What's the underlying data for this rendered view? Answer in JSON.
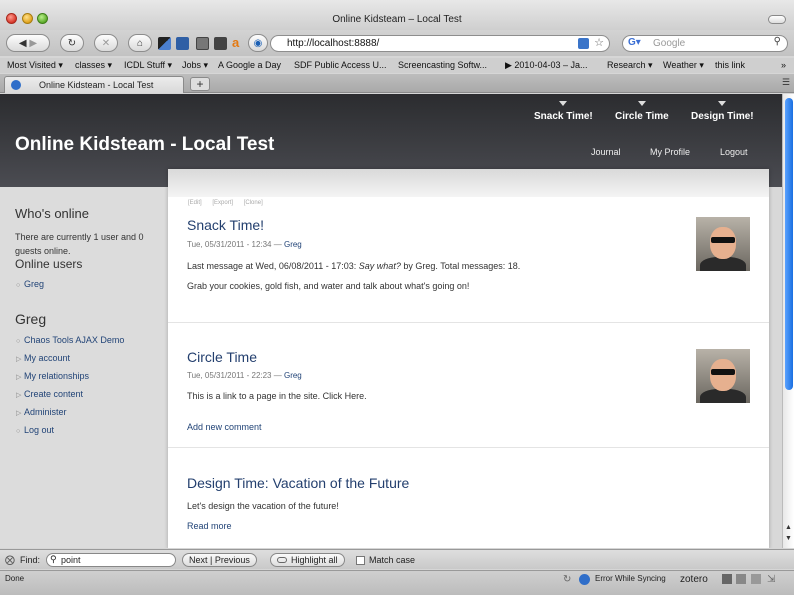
{
  "window": {
    "title": "Online Kidsteam – Local Test"
  },
  "nav": {
    "url": "http://localhost:8888/",
    "search_placeholder": "Google"
  },
  "bookmarks": [
    "Most Visited ▾",
    "classes ▾",
    "ICDL Stuff ▾",
    "Jobs ▾",
    "A Google a Day",
    "SDF Public Access U...",
    "Screencasting Softw...",
    "▶ 2010-04-03 – Ja...",
    "Research ▾",
    "Weather ▾",
    "this link",
    "»"
  ],
  "tab": {
    "label": "Online Kidsteam - Local Test",
    "new_tab": "+"
  },
  "site": {
    "title": "Online Kidsteam - Local Test",
    "primary_links": [
      "Snack Time!",
      "Circle Time",
      "Design Time!"
    ],
    "secondary_links": [
      "Journal",
      "My Profile",
      "Logout"
    ]
  },
  "sidebar": {
    "whos_online_title": "Who's online",
    "whos_online_text": "There are currently 1 user and 0 guests online.",
    "online_users_title": "Online users",
    "online_user": "Greg",
    "user_block_title": "Greg",
    "user_menu": [
      "Chaos Tools AJAX Demo",
      "My account",
      "My relationships",
      "Create content",
      "Administer",
      "Log out"
    ]
  },
  "content": {
    "edit_links": [
      "[Edit]",
      "[Export]",
      "[Clone]"
    ],
    "nodes": [
      {
        "title": "Snack Time!",
        "meta_date": "Tue, 05/31/2011 - 12:34 —",
        "meta_author": "Greg",
        "last_message_prefix": "Last message at Wed, 06/08/2011 - 17:03:",
        "last_message_italic": "Say what?",
        "last_message_suffix": "by Greg. Total messages: 18.",
        "body": "Grab your cookies, gold fish, and water and talk about what's going on!"
      },
      {
        "title": "Circle Time",
        "meta_date": "Tue, 05/31/2011 - 22:23 —",
        "meta_author": "Greg",
        "body": "This is a link to a page in the site. Click Here.",
        "link": "Add new comment"
      },
      {
        "title": "Design Time: Vacation of the Future",
        "body": "Let's design the vacation of the future!",
        "link": "Read more"
      }
    ]
  },
  "findbar": {
    "label": "Find:",
    "query": "point",
    "next": "Next",
    "previous": "Previous",
    "highlight": "Highlight all",
    "match_case": "Match case"
  },
  "status": {
    "left": "Done",
    "sync": "Error While Syncing",
    "zotero": "zotero"
  }
}
